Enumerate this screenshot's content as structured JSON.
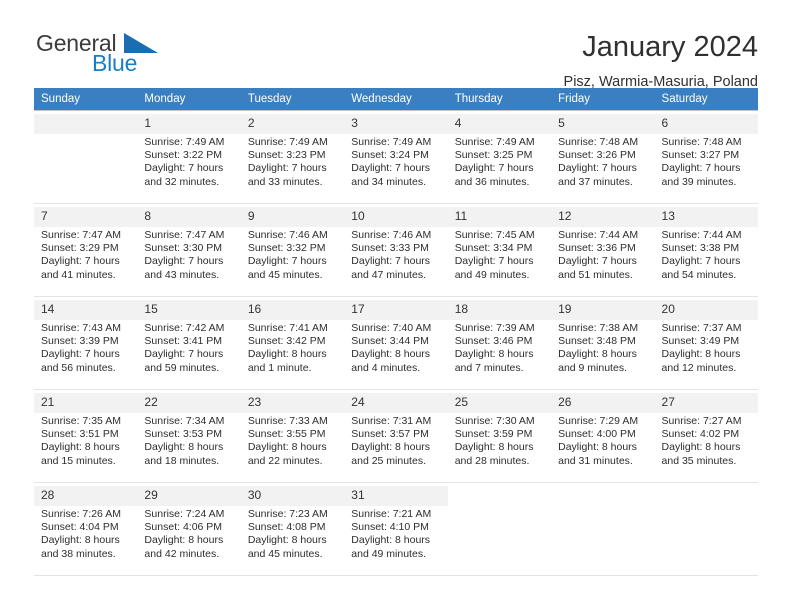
{
  "brand": {
    "name_part1": "General",
    "name_part2": "Blue",
    "accent_color": "#1b7dc4",
    "triangle_color": "#1b6cb0"
  },
  "header": {
    "title": "January 2024",
    "subtitle": "Pisz, Warmia-Masuria, Poland"
  },
  "calendar": {
    "header_bg": "#3a7fc1",
    "weekdays": [
      "Sunday",
      "Monday",
      "Tuesday",
      "Wednesday",
      "Thursday",
      "Friday",
      "Saturday"
    ],
    "weeks": [
      [
        {
          "day": "",
          "info": ""
        },
        {
          "day": "1",
          "info": "Sunrise: 7:49 AM\nSunset: 3:22 PM\nDaylight: 7 hours\nand 32 minutes."
        },
        {
          "day": "2",
          "info": "Sunrise: 7:49 AM\nSunset: 3:23 PM\nDaylight: 7 hours\nand 33 minutes."
        },
        {
          "day": "3",
          "info": "Sunrise: 7:49 AM\nSunset: 3:24 PM\nDaylight: 7 hours\nand 34 minutes."
        },
        {
          "day": "4",
          "info": "Sunrise: 7:49 AM\nSunset: 3:25 PM\nDaylight: 7 hours\nand 36 minutes."
        },
        {
          "day": "5",
          "info": "Sunrise: 7:48 AM\nSunset: 3:26 PM\nDaylight: 7 hours\nand 37 minutes."
        },
        {
          "day": "6",
          "info": "Sunrise: 7:48 AM\nSunset: 3:27 PM\nDaylight: 7 hours\nand 39 minutes."
        }
      ],
      [
        {
          "day": "7",
          "info": "Sunrise: 7:47 AM\nSunset: 3:29 PM\nDaylight: 7 hours\nand 41 minutes."
        },
        {
          "day": "8",
          "info": "Sunrise: 7:47 AM\nSunset: 3:30 PM\nDaylight: 7 hours\nand 43 minutes."
        },
        {
          "day": "9",
          "info": "Sunrise: 7:46 AM\nSunset: 3:32 PM\nDaylight: 7 hours\nand 45 minutes."
        },
        {
          "day": "10",
          "info": "Sunrise: 7:46 AM\nSunset: 3:33 PM\nDaylight: 7 hours\nand 47 minutes."
        },
        {
          "day": "11",
          "info": "Sunrise: 7:45 AM\nSunset: 3:34 PM\nDaylight: 7 hours\nand 49 minutes."
        },
        {
          "day": "12",
          "info": "Sunrise: 7:44 AM\nSunset: 3:36 PM\nDaylight: 7 hours\nand 51 minutes."
        },
        {
          "day": "13",
          "info": "Sunrise: 7:44 AM\nSunset: 3:38 PM\nDaylight: 7 hours\nand 54 minutes."
        }
      ],
      [
        {
          "day": "14",
          "info": "Sunrise: 7:43 AM\nSunset: 3:39 PM\nDaylight: 7 hours\nand 56 minutes."
        },
        {
          "day": "15",
          "info": "Sunrise: 7:42 AM\nSunset: 3:41 PM\nDaylight: 7 hours\nand 59 minutes."
        },
        {
          "day": "16",
          "info": "Sunrise: 7:41 AM\nSunset: 3:42 PM\nDaylight: 8 hours\nand 1 minute."
        },
        {
          "day": "17",
          "info": "Sunrise: 7:40 AM\nSunset: 3:44 PM\nDaylight: 8 hours\nand 4 minutes."
        },
        {
          "day": "18",
          "info": "Sunrise: 7:39 AM\nSunset: 3:46 PM\nDaylight: 8 hours\nand 7 minutes."
        },
        {
          "day": "19",
          "info": "Sunrise: 7:38 AM\nSunset: 3:48 PM\nDaylight: 8 hours\nand 9 minutes."
        },
        {
          "day": "20",
          "info": "Sunrise: 7:37 AM\nSunset: 3:49 PM\nDaylight: 8 hours\nand 12 minutes."
        }
      ],
      [
        {
          "day": "21",
          "info": "Sunrise: 7:35 AM\nSunset: 3:51 PM\nDaylight: 8 hours\nand 15 minutes."
        },
        {
          "day": "22",
          "info": "Sunrise: 7:34 AM\nSunset: 3:53 PM\nDaylight: 8 hours\nand 18 minutes."
        },
        {
          "day": "23",
          "info": "Sunrise: 7:33 AM\nSunset: 3:55 PM\nDaylight: 8 hours\nand 22 minutes."
        },
        {
          "day": "24",
          "info": "Sunrise: 7:31 AM\nSunset: 3:57 PM\nDaylight: 8 hours\nand 25 minutes."
        },
        {
          "day": "25",
          "info": "Sunrise: 7:30 AM\nSunset: 3:59 PM\nDaylight: 8 hours\nand 28 minutes."
        },
        {
          "day": "26",
          "info": "Sunrise: 7:29 AM\nSunset: 4:00 PM\nDaylight: 8 hours\nand 31 minutes."
        },
        {
          "day": "27",
          "info": "Sunrise: 7:27 AM\nSunset: 4:02 PM\nDaylight: 8 hours\nand 35 minutes."
        }
      ],
      [
        {
          "day": "28",
          "info": "Sunrise: 7:26 AM\nSunset: 4:04 PM\nDaylight: 8 hours\nand 38 minutes."
        },
        {
          "day": "29",
          "info": "Sunrise: 7:24 AM\nSunset: 4:06 PM\nDaylight: 8 hours\nand 42 minutes."
        },
        {
          "day": "30",
          "info": "Sunrise: 7:23 AM\nSunset: 4:08 PM\nDaylight: 8 hours\nand 45 minutes."
        },
        {
          "day": "31",
          "info": "Sunrise: 7:21 AM\nSunset: 4:10 PM\nDaylight: 8 hours\nand 49 minutes."
        },
        {
          "day": "",
          "info": ""
        },
        {
          "day": "",
          "info": ""
        },
        {
          "day": "",
          "info": ""
        }
      ]
    ]
  }
}
